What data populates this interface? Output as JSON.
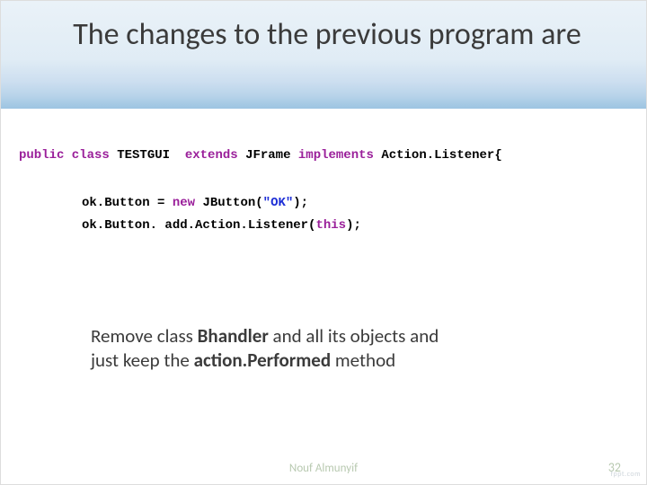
{
  "title": "The changes to the previous program are",
  "code": {
    "l1": {
      "kw1": "public class ",
      "name": "TESTGUI ",
      "kw2": " extends ",
      "sup": "JFrame",
      "kw3": " implements ",
      "iface": "Action.Listener{"
    },
    "l2": {
      "pre": "ok.Button = ",
      "kw": "new",
      "mid": " JButton(",
      "str": "\"OK\"",
      "post": ");"
    },
    "l3": {
      "pre": "ok.Button. add.Action.Listener(",
      "kw": "this",
      "post": ");"
    }
  },
  "explain": {
    "pre1": "Remove class ",
    "b1": "Bhandler",
    "mid1": " and all its objects and",
    "line2_pre": " just keep the  ",
    "b2": "action.Performed",
    "line2_post": " method"
  },
  "footer": {
    "author": "Nouf Almunyif",
    "page": "32",
    "brand": "fppt.com"
  }
}
